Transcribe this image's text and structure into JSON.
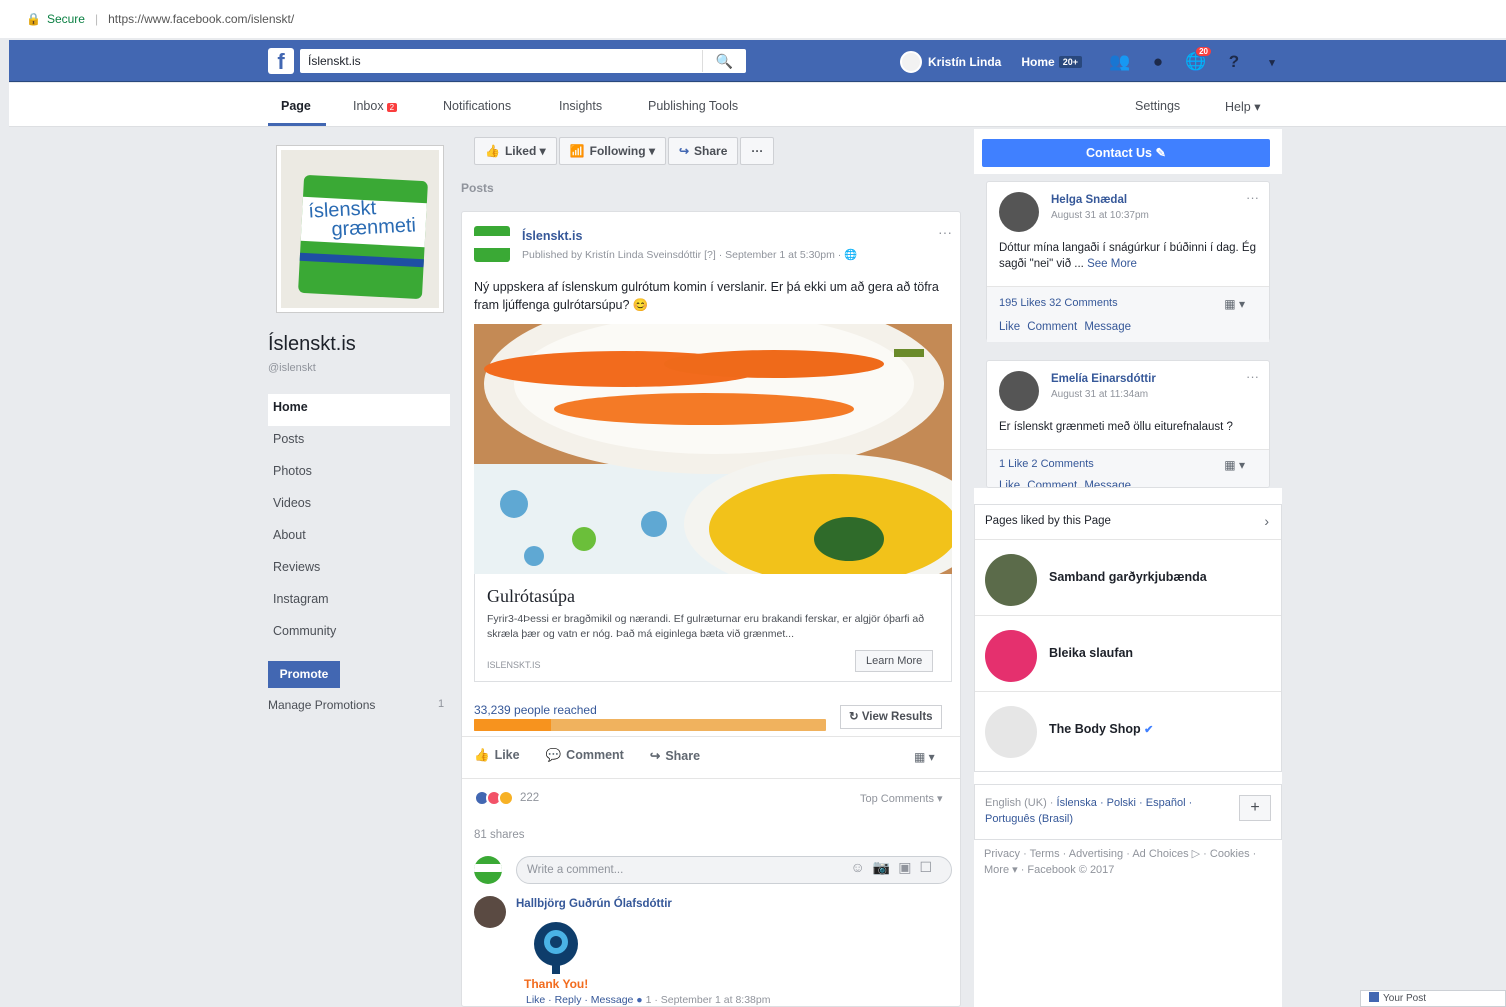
{
  "browser": {
    "secure_label": "Secure",
    "url": "https://www.facebook.com/islenskt/"
  },
  "topbar": {
    "logo": "f",
    "search_value": "Íslenskt.is",
    "search_placeholder": "Search",
    "user_name": "Kristín Linda",
    "home_label": "Home",
    "home_badge": "20+",
    "notif_count": "20",
    "icons": [
      "friends-icon",
      "messenger-icon",
      "notifications-icon",
      "help-icon",
      "menu-arrow-icon"
    ]
  },
  "pagenav": {
    "items": [
      "Page",
      "Inbox",
      "Notifications",
      "Insights",
      "Publishing Tools"
    ],
    "inbox_badge": "2",
    "settings": "Settings",
    "help": "Help"
  },
  "page": {
    "name": "Íslenskt.is",
    "handle": "@islenskt",
    "logo_text_1": "íslenskt",
    "logo_text_2": "grænmeti"
  },
  "leftnav": {
    "items": [
      "Home",
      "Posts",
      "Photos",
      "Videos",
      "About",
      "Reviews",
      "Instagram",
      "Community"
    ],
    "promote": "Promote",
    "manage_promotions": "Manage Promotions",
    "manage_count": "1"
  },
  "actions": {
    "liked": "Liked",
    "following": "Following",
    "share": "Share",
    "more": "···"
  },
  "posts_label": "Posts",
  "post": {
    "author": "Íslenskt.is",
    "meta": "Published by Kristín Linda Sveinsdóttir [?] · September 1 at 5:30pm · 🌐",
    "text": "Ný uppskera af íslenskum gulrótum komin í verslanir. Er þá ekki um að gera að töfra fram ljúffenga gulrótarsúpu? 😊",
    "link_title": "Gulrótasúpa",
    "link_desc": "Fyrir3-4Þessi er bragðmikil og nærandi. Ef gulræturnar eru brakandi ferskar, er algjör óþarfi að skræla þær og vatn er nóg. Það má eiginlega bæta við grænmet...",
    "link_domain": "ISLENSKT.IS",
    "learn_more": "Learn More",
    "reach": "33,239 people reached",
    "reach_fraction": 0.22,
    "view_results": "View Results",
    "like": "Like",
    "comment": "Comment",
    "share": "Share",
    "reaction_count": "222",
    "top_comments": "Top Comments",
    "shares": "81 shares",
    "comment_placeholder": "Write a comment...",
    "commenter": "Hallbjörg Guðrún Ólafsdóttir",
    "sticker_text": "Thank You!",
    "comment_actions": "Like · Reply · Message",
    "comment_likes": "1",
    "comment_time": "· September 1 at 8:38pm"
  },
  "right": {
    "contact_btn": "Contact Us ✎",
    "visitor_posts": [
      {
        "name": "Helga Snædal",
        "time": "August 31 at 10:37pm",
        "text": "Dóttur mína langaði í snágúrkur í búðinni í dag. Ég sagði \"nei\" við ...",
        "see_more": "See More",
        "stats": "195 Likes   32 Comments",
        "actions": "Like   Comment   Message"
      },
      {
        "name": "Emelía Einarsdóttir",
        "time": "August 31 at 11:34am",
        "text": "Er íslenskt grænmeti með öllu eiturefnalaust ?",
        "see_more": "",
        "stats": "1 Like   2 Comments",
        "actions": "Like   Comment   Message"
      }
    ],
    "liked_header": "Pages liked by this Page",
    "liked_pages": [
      "Samband garðyrkjubænda",
      "Bleika slaufan",
      "The Body Shop"
    ],
    "languages": {
      "current": "English (UK) · ",
      "links": "Íslenska · Polski · Español · Português (Brasil)"
    },
    "footer": "Privacy · Terms · Advertising · Ad Choices ▷ · Cookies · More ▾ · Facebook © 2017"
  },
  "chat": {
    "your_post": "Your Post"
  }
}
